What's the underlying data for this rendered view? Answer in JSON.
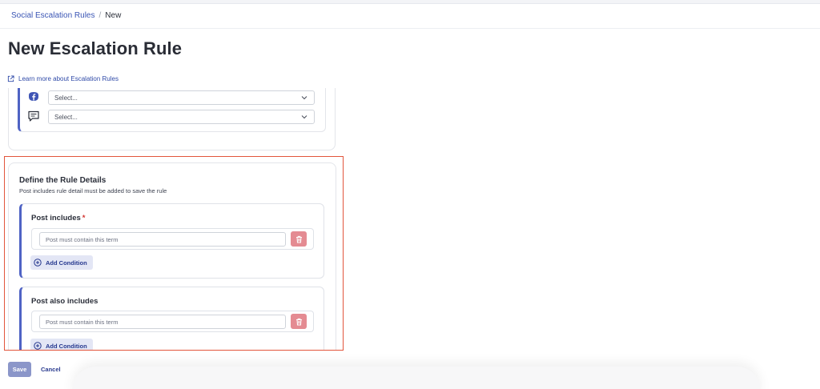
{
  "breadcrumb": {
    "parent": "Social Escalation Rules",
    "separator": "/",
    "current": "New"
  },
  "page": {
    "title": "New Escalation Rule",
    "learn_link": "Learn more about Escalation Rules"
  },
  "channels": {
    "rows": [
      {
        "icon": "facebook-icon",
        "select_value": "Select..."
      },
      {
        "icon": "message-icon",
        "select_value": "Select..."
      }
    ]
  },
  "rule_details": {
    "title": "Define the Rule Details",
    "subtitle": "Post includes rule detail must be added to save the rule",
    "groups": [
      {
        "label": "Post includes",
        "required_mark": "*",
        "placeholder": "Post must contain this term",
        "add_label": "Add Condition"
      },
      {
        "label": "Post also includes",
        "required_mark": "",
        "placeholder": "Post must contain this term",
        "add_label": "Add Condition"
      }
    ]
  },
  "footer": {
    "save_label": "Save",
    "cancel_label": "Cancel"
  },
  "colors": {
    "accent": "#4f63c4",
    "link": "#3a55b4",
    "highlight": "#e2553c",
    "danger": "#e48b92",
    "save_disabled": "#8b96c9"
  }
}
